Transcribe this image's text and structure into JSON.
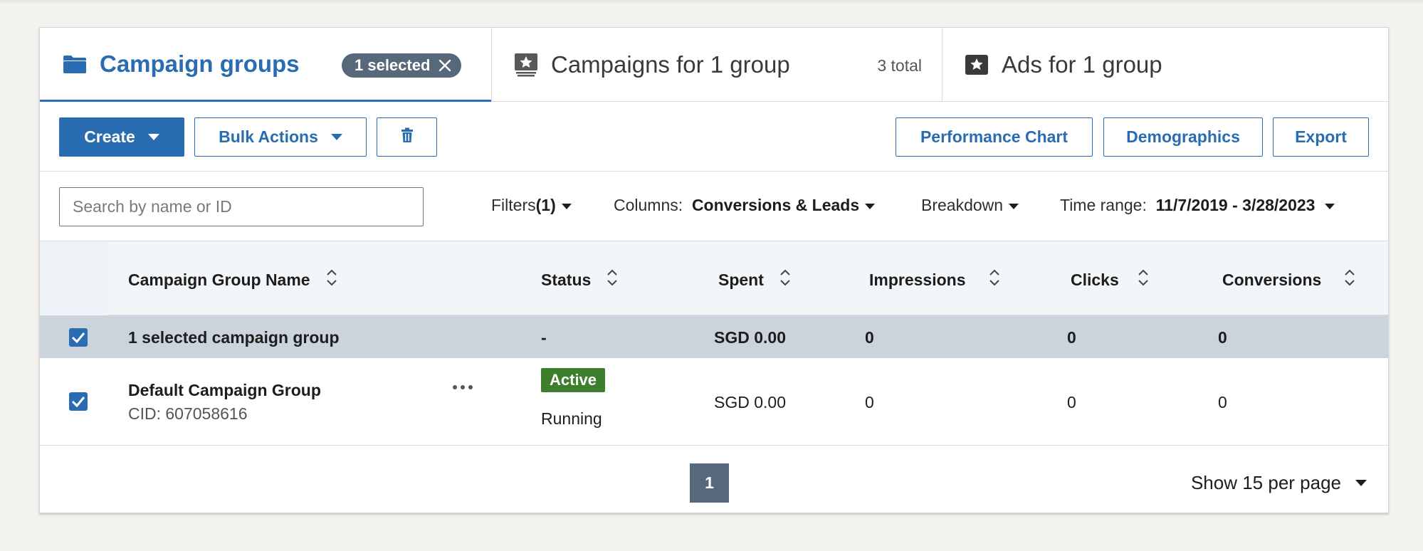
{
  "tabs": {
    "campaign_groups": {
      "label": "Campaign groups",
      "selected_badge": "1 selected"
    },
    "campaigns": {
      "label": "Campaigns for 1 group",
      "count": "3 total"
    },
    "ads": {
      "label": "Ads for 1 group"
    }
  },
  "toolbar": {
    "create_label": "Create",
    "bulk_actions_label": "Bulk Actions",
    "performance_chart_label": "Performance Chart",
    "demographics_label": "Demographics",
    "export_label": "Export"
  },
  "filters": {
    "search_placeholder": "Search by name or ID",
    "filters_label": "Filters",
    "filters_count": "(1)",
    "columns_label": "Columns:",
    "columns_value": "Conversions & Leads",
    "breakdown_label": "Breakdown",
    "time_range_label": "Time range:",
    "time_range_value": "11/7/2019 - 3/28/2023"
  },
  "table": {
    "columns": {
      "name": "Campaign Group Name",
      "status": "Status",
      "spent": "Spent",
      "impressions": "Impressions",
      "clicks": "Clicks",
      "conversions": "Conversions"
    },
    "summary": {
      "label": "1 selected campaign group",
      "status": "-",
      "spent": "SGD 0.00",
      "impressions": "0",
      "clicks": "0",
      "conversions": "0"
    },
    "rows": [
      {
        "name": "Default Campaign Group",
        "cid": "CID: 607058616",
        "status_badge": "Active",
        "status_text": "Running",
        "spent": "SGD 0.00",
        "impressions": "0",
        "clicks": "0",
        "conversions": "0"
      }
    ]
  },
  "pagination": {
    "current_page": "1",
    "per_page_label": "Show 15 per page"
  },
  "colors": {
    "primary": "#2a6cb1",
    "link": "#6153c6",
    "active_badge": "#3d7f2d",
    "pill": "#56687a"
  }
}
